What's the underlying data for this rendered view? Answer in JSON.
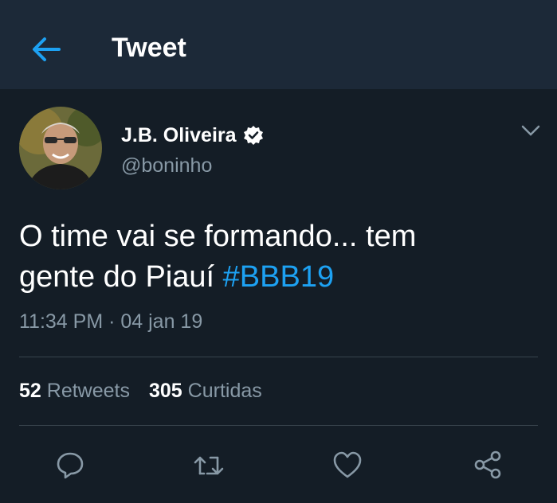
{
  "header": {
    "title": "Tweet",
    "back_icon": "arrow-left-icon",
    "accent": "#1da1f2"
  },
  "author": {
    "name": "J.B. Oliveira",
    "handle": "@boninho",
    "verified_icon": "verified-badge-icon"
  },
  "tweet": {
    "text_line1": "O time vai se formando... tem",
    "text_line2": "gente do Piauí",
    "hashtag": "#BBB19",
    "timestamp": "11:34 PM · 04 jan 19"
  },
  "stats": {
    "retweets_count": "52",
    "retweets_label": "Retweets",
    "likes_count": "305",
    "likes_label": "Curtidas"
  },
  "actions": {
    "icons": [
      "reply-icon",
      "retweet-icon",
      "like-icon",
      "share-icon"
    ]
  },
  "colors": {
    "background": "#141d26",
    "header_bg": "#1c2938",
    "secondary_text": "#8899a6",
    "link": "#1da1f2"
  }
}
